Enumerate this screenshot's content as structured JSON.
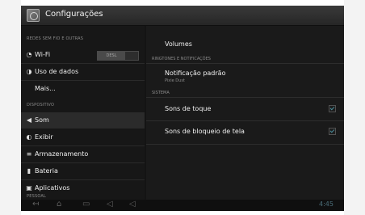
{
  "window": {
    "title": "Configurações"
  },
  "left_panel": {
    "sections": [
      {
        "title": "REDES SEM FIO E OUTRAS"
      },
      {
        "title": "DISPOSITIVO"
      },
      {
        "title": "PESSOAL"
      }
    ],
    "items": [
      {
        "label": "Wi-Fi",
        "icon": "wifi-icon"
      },
      {
        "label": "Uso de dados",
        "icon": "data-usage-icon"
      },
      {
        "label": "Mais...",
        "icon": ""
      },
      {
        "label": "Som",
        "icon": "volume-icon"
      },
      {
        "label": "Exibir",
        "icon": "display-icon"
      },
      {
        "label": "Armazenamento",
        "icon": "storage-icon"
      },
      {
        "label": "Bateria",
        "icon": "battery-icon"
      },
      {
        "label": "Aplicativos",
        "icon": "apps-icon"
      }
    ],
    "wifi_toggle": "DESL"
  },
  "right_panel": {
    "volumes_label": "Volumes",
    "section_ringtones": "RINGTONES E NOTIFICAÇÕES",
    "notification_label": "Notificação padrão",
    "notification_sub": "Pixie Dust",
    "section_system": "SISTEMA",
    "touch_sounds_label": "Sons de toque",
    "screen_lock_sounds_label": "Sons de bloqueio de tela"
  },
  "navbar": {
    "icons": [
      "back-icon",
      "home-icon",
      "recent-apps-icon",
      "volume-down-icon",
      "volume-up-icon"
    ],
    "clock_text": "4:45"
  },
  "colors": {
    "background": "#141414",
    "accent": "#4a8f9c"
  }
}
